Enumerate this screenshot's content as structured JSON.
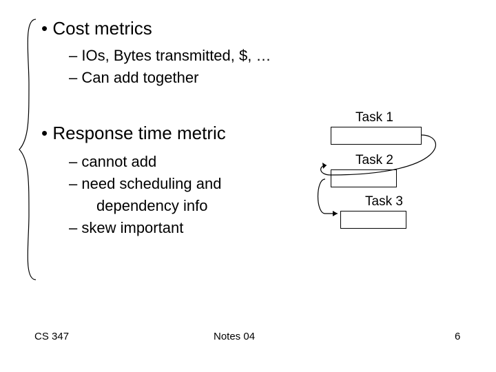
{
  "bullets": {
    "cost": {
      "title": "Cost metrics",
      "sub1": "IOs, Bytes transmitted, $, …",
      "sub2": "Can add together"
    },
    "resp": {
      "title": "Response time metric",
      "sub1": "cannot add",
      "sub2": "need scheduling and",
      "sub2b": "dependency info",
      "sub3": "skew important"
    }
  },
  "tasks": {
    "t1": "Task 1",
    "t2": "Task 2",
    "t3": "Task 3"
  },
  "footer": {
    "left": "CS 347",
    "center": "Notes 04",
    "right": "6"
  },
  "glyphs": {
    "bullet": "•",
    "dash": "–"
  }
}
